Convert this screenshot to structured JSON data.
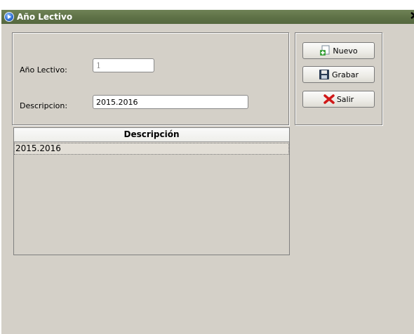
{
  "window": {
    "title": "Año Lectivo",
    "close_glyph": "×"
  },
  "form": {
    "year_label": "Año Lectivo:",
    "year_value": "1",
    "description_label": "Descripcion:",
    "description_value": "2015.2016"
  },
  "buttons": {
    "nuevo_label": "Nuevo",
    "grabar_label": "Grabar",
    "salir_label": "Salir"
  },
  "table": {
    "columns": [
      "Descripción"
    ],
    "rows": [
      [
        "2015.2016"
      ]
    ]
  },
  "icons": {
    "title": "app-circle-icon",
    "nuevo": "new-document-icon",
    "grabar": "floppy-disk-icon",
    "salir": "red-x-icon"
  },
  "colors": {
    "titlebar": "#5e7146",
    "window_bg": "#d4d0c8"
  }
}
